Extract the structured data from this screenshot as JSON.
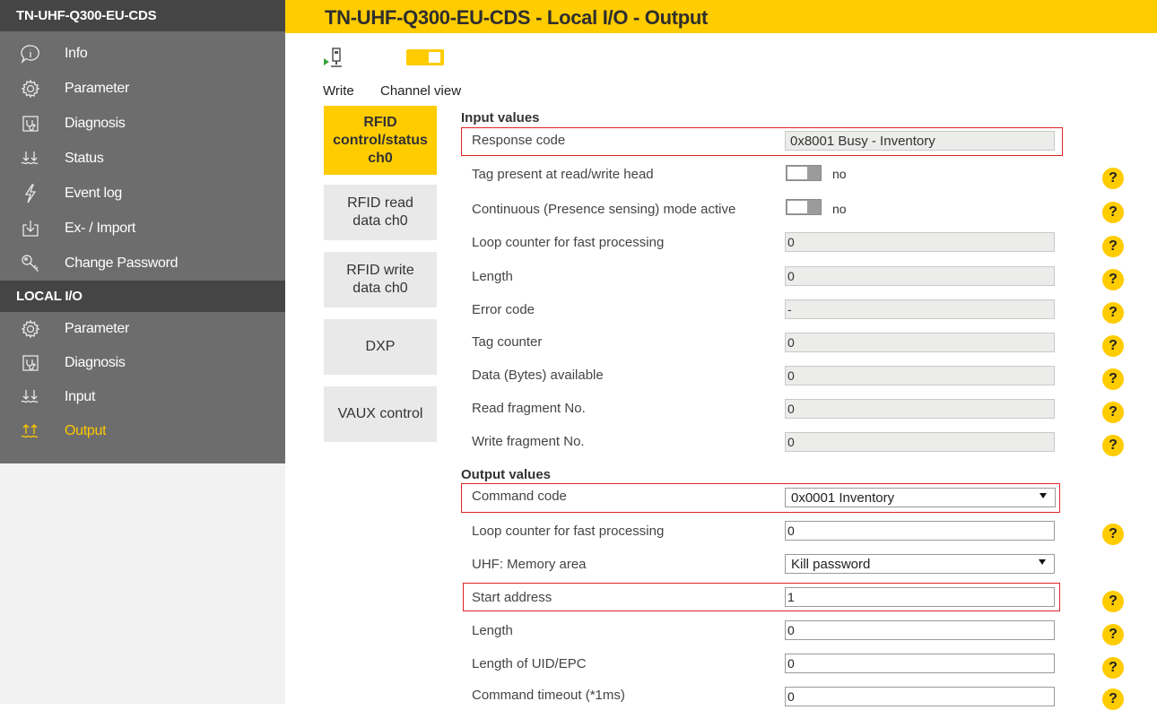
{
  "sidebar": {
    "device_title": "TN-UHF-Q300-EU-CDS",
    "device_items": [
      {
        "label": "Info",
        "icon": "info-icon"
      },
      {
        "label": "Parameter",
        "icon": "gear-icon"
      },
      {
        "label": "Diagnosis",
        "icon": "diagnosis-icon"
      },
      {
        "label": "Status",
        "icon": "status-icon"
      },
      {
        "label": "Event log",
        "icon": "lightning-icon"
      },
      {
        "label": "Ex- / Import",
        "icon": "import-icon"
      },
      {
        "label": "Change Password",
        "icon": "key-icon"
      }
    ],
    "local_title": "LOCAL I/O",
    "local_items": [
      {
        "label": "Parameter",
        "icon": "gear-icon"
      },
      {
        "label": "Diagnosis",
        "icon": "diagnosis-icon"
      },
      {
        "label": "Input",
        "icon": "input-icon"
      },
      {
        "label": "Output",
        "icon": "output-icon",
        "active": true
      }
    ]
  },
  "header": {
    "title": "TN-UHF-Q300-EU-CDS - Local I/O - Output"
  },
  "toolbar": {
    "write_label": "Write",
    "channel_view_label": "Channel view"
  },
  "tabs": [
    {
      "label_lines": [
        "RFID",
        "control/status",
        "ch0"
      ],
      "active": true
    },
    {
      "label_lines": [
        "RFID read",
        "data ch0"
      ]
    },
    {
      "label_lines": [
        "RFID write",
        "data ch0"
      ]
    },
    {
      "label_lines": [
        "DXP"
      ]
    },
    {
      "label_lines": [
        "VAUX control"
      ]
    }
  ],
  "input_values": {
    "title": "Input values",
    "response_code": {
      "label": "Response code",
      "value": "0x8001 Busy - Inventory"
    },
    "tag_present": {
      "label": "Tag present at read/write head",
      "value": "no"
    },
    "continuous_mode": {
      "label": "Continuous (Presence sensing) mode active",
      "value": "no"
    },
    "loop_counter": {
      "label": "Loop counter for fast processing",
      "value": "0"
    },
    "length": {
      "label": "Length",
      "value": "0"
    },
    "error_code": {
      "label": "Error code",
      "value": "-"
    },
    "tag_counter": {
      "label": "Tag counter",
      "value": "0"
    },
    "data_available": {
      "label": "Data (Bytes) available",
      "value": "0"
    },
    "read_fragment": {
      "label": "Read fragment No.",
      "value": "0"
    },
    "write_fragment": {
      "label": "Write fragment No.",
      "value": "0"
    }
  },
  "output_values": {
    "title": "Output values",
    "command_code": {
      "label": "Command code",
      "value": "0x0001 Inventory"
    },
    "loop_counter": {
      "label": "Loop counter for fast processing",
      "value": "0"
    },
    "memory_area": {
      "label": "UHF: Memory area",
      "value": "Kill password"
    },
    "start_address": {
      "label": "Start address",
      "value": "1"
    },
    "length": {
      "label": "Length",
      "value": "0"
    },
    "uid_length": {
      "label": "Length of UID/EPC",
      "value": "0"
    },
    "command_timeout": {
      "label": "Command timeout (*1ms)",
      "value": "0"
    }
  },
  "help_glyph": "?",
  "colors": {
    "accent": "#ffcc00",
    "sidebar": "#6d6d6d",
    "sidebar_header": "#454545",
    "highlight": "#e02424"
  }
}
